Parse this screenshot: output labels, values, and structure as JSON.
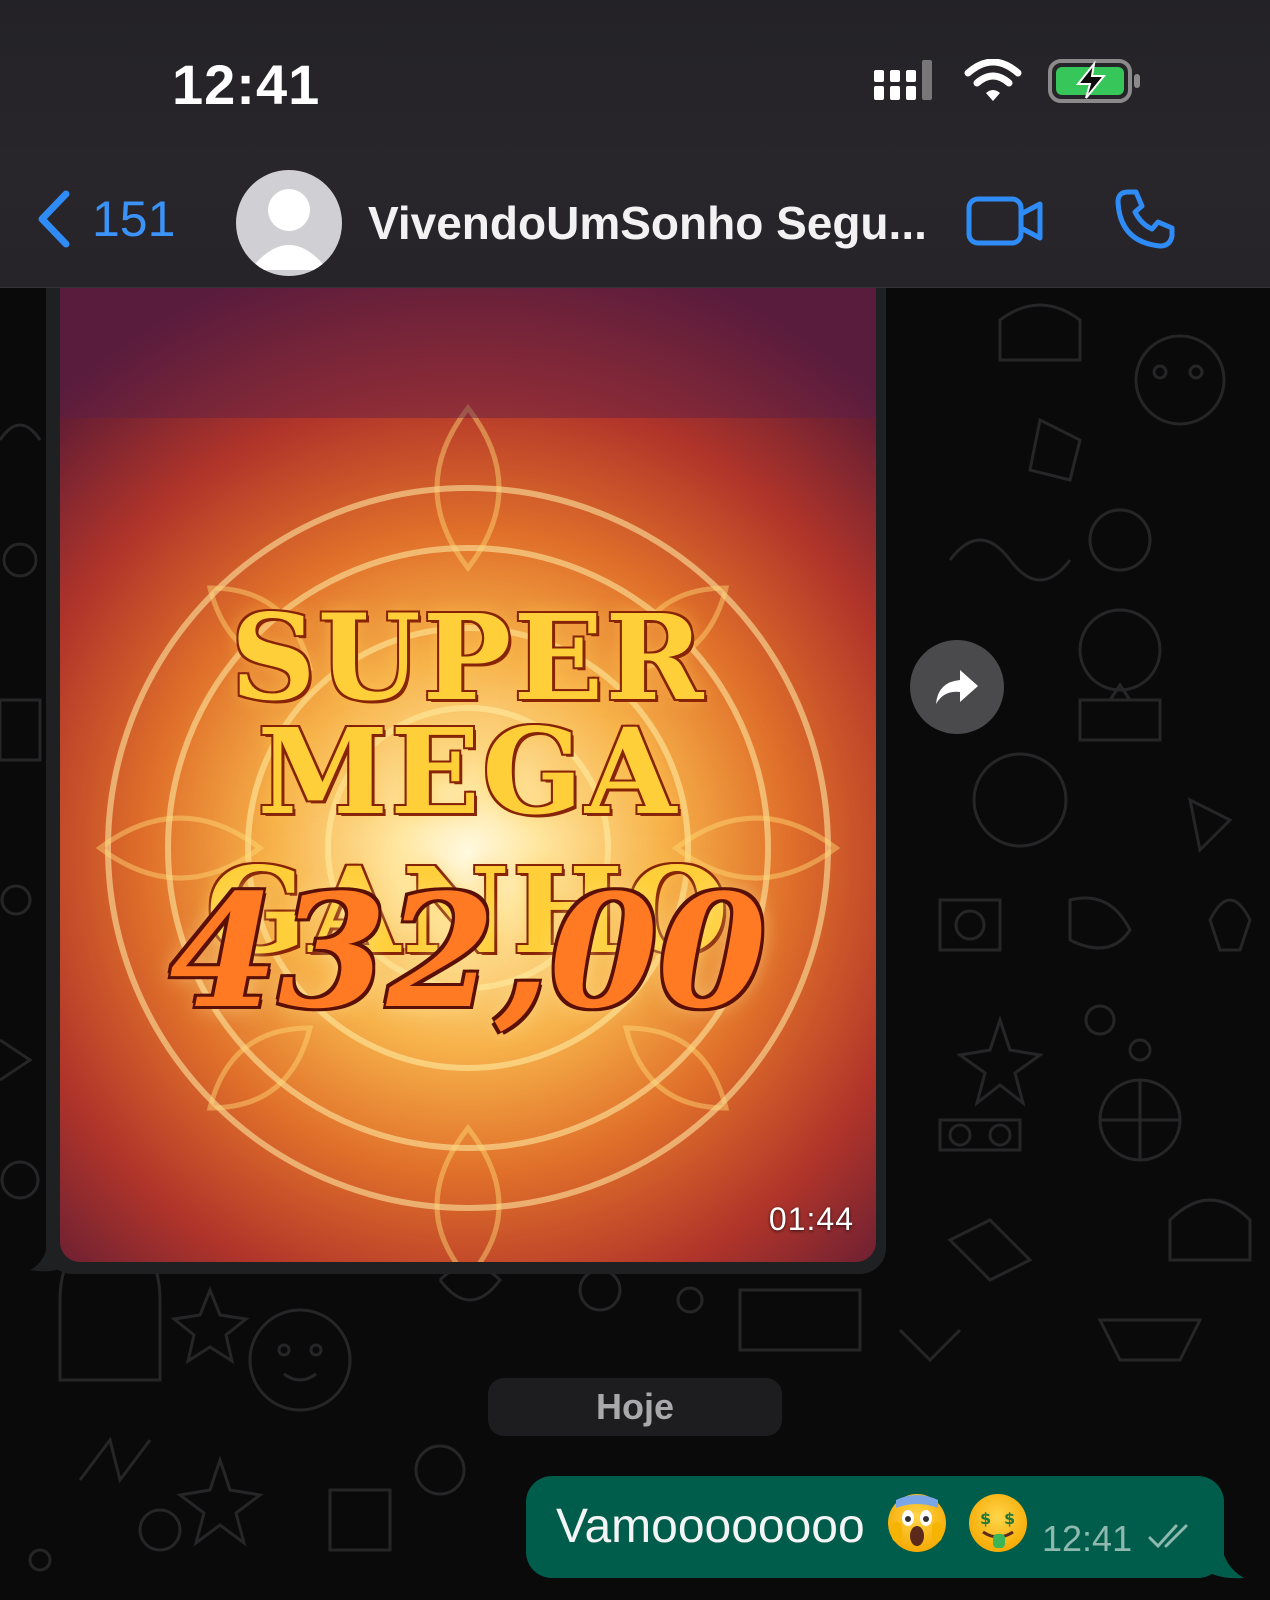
{
  "status_bar": {
    "time": "12:41",
    "icons": [
      "signal-icon",
      "wifi-icon",
      "battery-charging-icon"
    ]
  },
  "header": {
    "back_count": "151",
    "contact_name": "VivendoUmSonho Segu...",
    "actions": [
      "video-call-icon",
      "voice-call-icon"
    ]
  },
  "video_message": {
    "overlay_line1": "SUPER",
    "overlay_line2": "MEGA GANHO",
    "overlay_amount": "432,00",
    "duration": "01:44"
  },
  "date_separator": "Hoje",
  "outgoing_message": {
    "text": "Vamoooooooo",
    "emojis": [
      "face-screaming-icon",
      "money-mouth-face-icon"
    ],
    "time": "12:41",
    "status": "double-check-icon"
  },
  "colors": {
    "accent_blue": "#2f8cf6",
    "outgoing_bubble": "#005d4b",
    "chat_background": "#0a0a0a"
  }
}
